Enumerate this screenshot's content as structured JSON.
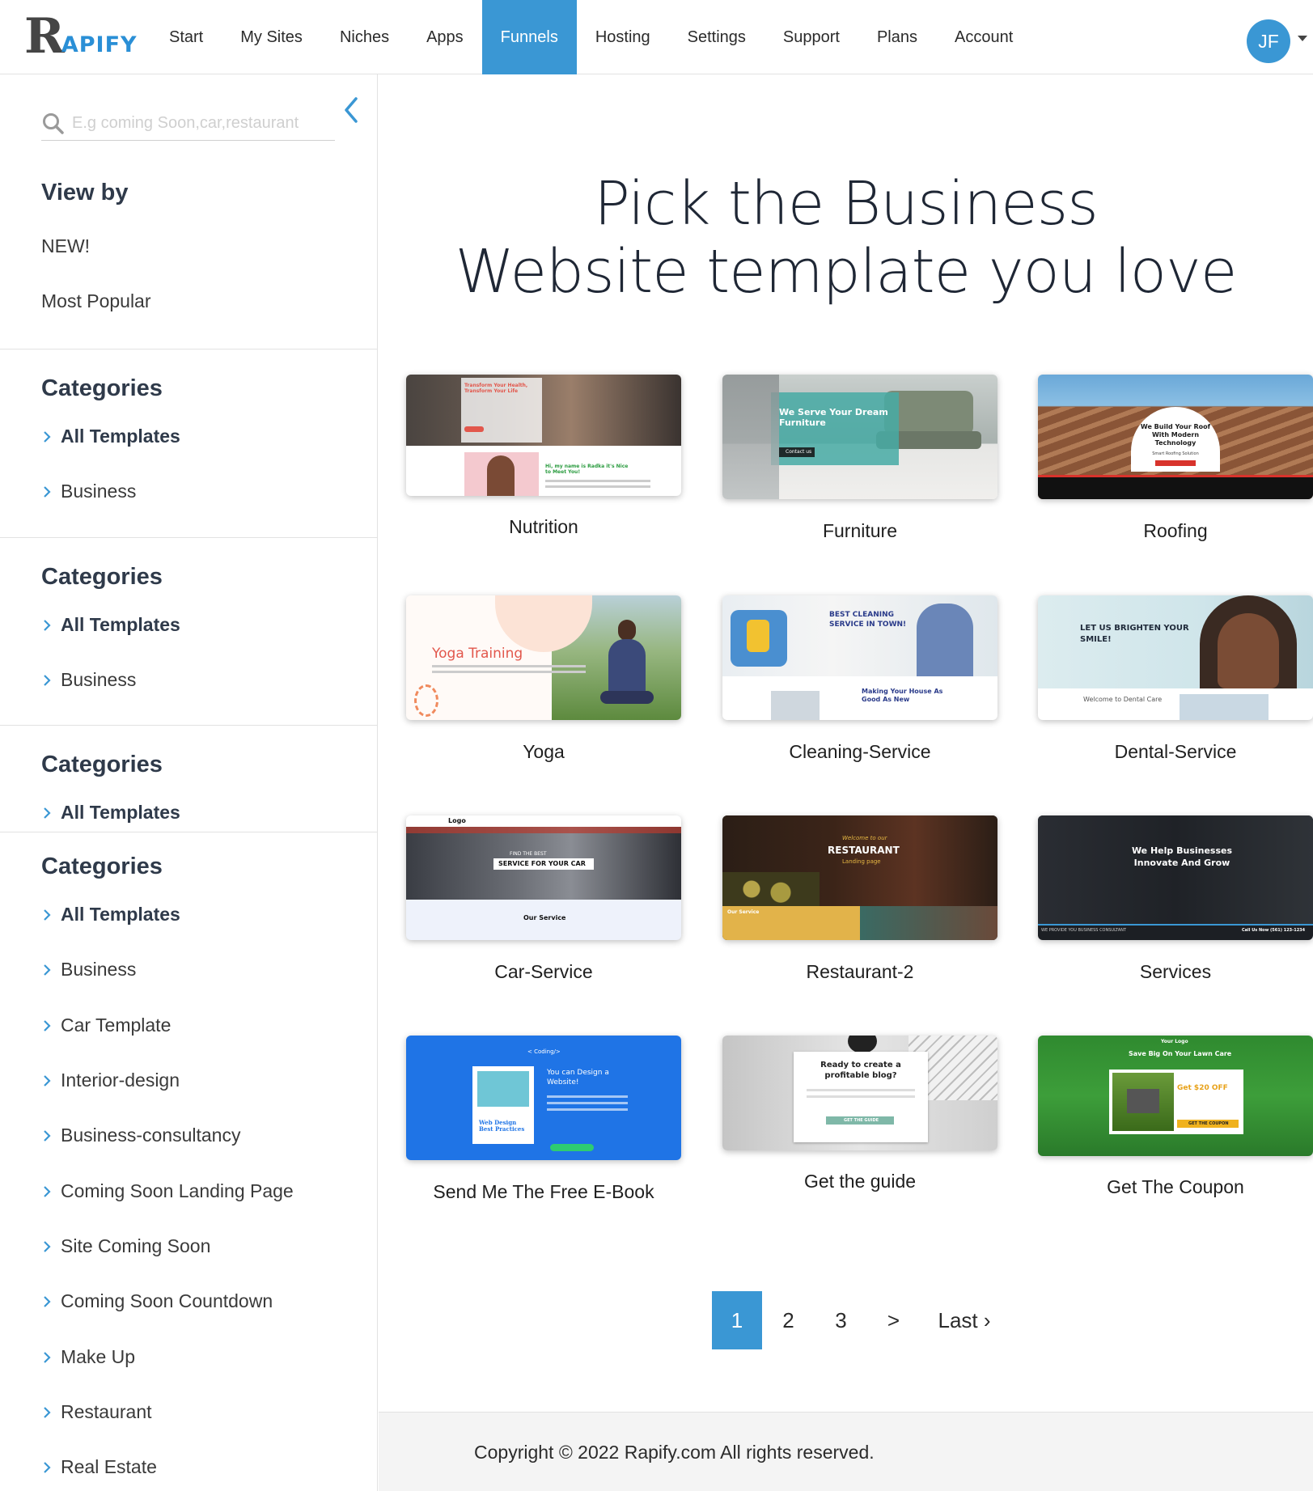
{
  "brand": {
    "logo_letter": "R",
    "logo_rest": "APIFY"
  },
  "nav": {
    "items": [
      {
        "label": "Start",
        "key": "start"
      },
      {
        "label": "My Sites",
        "key": "my-sites"
      },
      {
        "label": "Niches",
        "key": "niches"
      },
      {
        "label": "Apps",
        "key": "apps"
      },
      {
        "label": "Funnels",
        "key": "funnels",
        "active": true
      },
      {
        "label": "Hosting",
        "key": "hosting"
      },
      {
        "label": "Settings",
        "key": "settings"
      },
      {
        "label": "Support",
        "key": "support"
      },
      {
        "label": "Plans",
        "key": "plans"
      },
      {
        "label": "Account",
        "key": "account"
      }
    ],
    "avatar_initials": "JF"
  },
  "sidebar": {
    "search_placeholder": "E.g coming Soon,car,restaurant",
    "view_by": {
      "title": "View by",
      "items": [
        "NEW!",
        "Most Popular"
      ]
    },
    "categories_title": "Categories",
    "block1": [
      "All Templates",
      "Business"
    ],
    "block2": [
      "All Templates",
      "Business"
    ],
    "block3": [
      "All Templates"
    ],
    "block4": [
      "All Templates",
      "Business",
      "Car Template",
      "Interior-design",
      "Business-consultancy",
      "Coming Soon Landing Page",
      "Site Coming Soon",
      "Coming Soon Countdown",
      "Make Up",
      "Restaurant",
      "Real Estate"
    ]
  },
  "main": {
    "headline_line1": "Pick the Business",
    "headline_line2": "Website template you love",
    "templates": [
      {
        "name": "Nutrition",
        "thumb": {
          "h1": "Transform Your Health, Transform Your Life",
          "h2": "Hi, my name is Radka it's Nice to Meet You!"
        }
      },
      {
        "name": "Furniture",
        "thumb": {
          "h1": "We Serve Your Dream Furniture",
          "btn": "Contact us"
        }
      },
      {
        "name": "Roofing",
        "thumb": {
          "h1": "We Build Your Roof With Modern Technology",
          "sub": "Smart Roofing Solution"
        }
      },
      {
        "name": "Yoga",
        "thumb": {
          "h1": "Yoga Training"
        }
      },
      {
        "name": "Cleaning-Service",
        "thumb": {
          "h1": "BEST CLEANING SERVICE IN TOWN!",
          "h2": "Making Your House As Good As New"
        }
      },
      {
        "name": "Dental-Service",
        "thumb": {
          "h1": "LET US BRIGHTEN YOUR SMILE!",
          "h2": "Welcome to Dental Care"
        }
      },
      {
        "name": "Car-Service",
        "thumb": {
          "h1": "SERVICE FOR YOUR CAR",
          "pre": "FIND THE BEST",
          "h2": "Our Service",
          "logo": "Logo"
        }
      },
      {
        "name": "Restaurant-2",
        "thumb": {
          "pre": "Welcome to our",
          "h1": "RESTAURANT",
          "sub": "Landing page",
          "h2": "Our Service"
        }
      },
      {
        "name": "Services",
        "thumb": {
          "h1": "We Help Businesses Innovate And Grow",
          "foot": "WE PROVIDE YOU BUSINESS CONSULTANT",
          "phone": "Call Us Now (561) 123-1234"
        }
      },
      {
        "name": "Send Me The Free E-Book",
        "thumb": {
          "pre": "< Coding/>",
          "h1": "You can Design a Website!",
          "book": "Web Design Best Practices"
        }
      },
      {
        "name": "Get the guide",
        "thumb": {
          "h1": "Ready to create a profitable blog?",
          "btn": "GET THE GUIDE"
        }
      },
      {
        "name": "Get The Coupon",
        "thumb": {
          "logo": "Your Logo",
          "h1": "Save Big On Your Lawn Care",
          "offer": "Get $20 OFF",
          "btn": "GET THE COUPON"
        }
      }
    ]
  },
  "pagination": {
    "pages": [
      "1",
      "2",
      "3"
    ],
    "current": "1",
    "next": ">",
    "last": "Last ›"
  },
  "footer": {
    "copyright": "Copyright © 2022 Rapify.com All rights reserved."
  },
  "colors": {
    "accent": "#3a97d4",
    "text_dark": "#1f2735"
  }
}
